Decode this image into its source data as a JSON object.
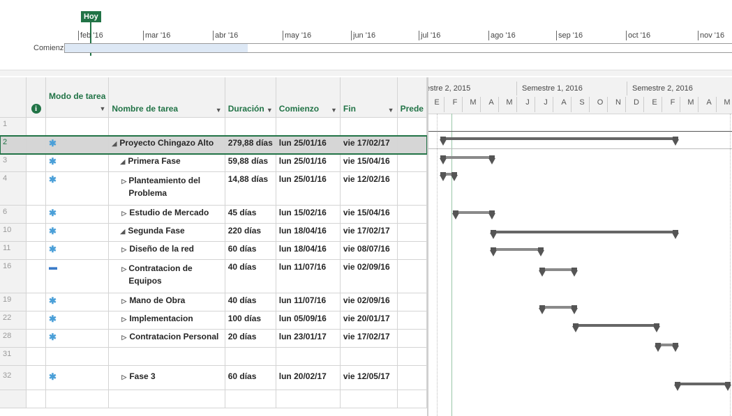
{
  "timeline": {
    "today_label": "Hoy",
    "start_label": "Comienzo",
    "months": [
      "feb '16",
      "mar '16",
      "abr '16",
      "may '16",
      "jun '16",
      "jul '16",
      "ago '16",
      "sep '16",
      "oct '16",
      "nov '16"
    ]
  },
  "grid": {
    "headers": {
      "info": "i",
      "mode": "Modo de tarea",
      "name": "Nombre de tarea",
      "duration": "Duración",
      "start": "Comienzo",
      "finish": "Fin",
      "pred": "Prede"
    },
    "rows": [
      {
        "id": "1",
        "mode": "",
        "name": "",
        "duration": "",
        "start": "",
        "finish": ""
      },
      {
        "id": "2",
        "mode": "pin",
        "name": "Proyecto Chingazo Alto",
        "duration": "279,88 días",
        "start": "lun 25/01/16",
        "finish": "vie 17/02/17"
      },
      {
        "id": "3",
        "mode": "pin",
        "name": "Primera Fase",
        "duration": "59,88 días",
        "start": "lun 25/01/16",
        "finish": "vie 15/04/16"
      },
      {
        "id": "4",
        "mode": "pin",
        "name": "Planteamiento del Problema",
        "duration": "14,88 días",
        "start": "lun 25/01/16",
        "finish": "vie 12/02/16"
      },
      {
        "id": "6",
        "mode": "pin",
        "name": "Estudio de Mercado",
        "duration": "45 días",
        "start": "lun 15/02/16",
        "finish": "vie 15/04/16"
      },
      {
        "id": "10",
        "mode": "pin",
        "name": "Segunda Fase",
        "duration": "220 días",
        "start": "lun 18/04/16",
        "finish": "vie 17/02/17"
      },
      {
        "id": "11",
        "mode": "pin",
        "name": "Diseño de la red",
        "duration": "60 días",
        "start": "lun 18/04/16",
        "finish": "vie 08/07/16"
      },
      {
        "id": "16",
        "mode": "auto",
        "name": "Contratacion de Equipos",
        "duration": "40 días",
        "start": "lun 11/07/16",
        "finish": "vie 02/09/16"
      },
      {
        "id": "19",
        "mode": "pin",
        "name": "Mano de Obra",
        "duration": "40 días",
        "start": "lun 11/07/16",
        "finish": "vie 02/09/16"
      },
      {
        "id": "22",
        "mode": "pin",
        "name": "Implementacion",
        "duration": "100 días",
        "start": "lun 05/09/16",
        "finish": "vie 20/01/17"
      },
      {
        "id": "28",
        "mode": "pin",
        "name": "Contratacion Personal",
        "duration": "20 días",
        "start": "lun 23/01/17",
        "finish": "vie 17/02/17"
      },
      {
        "id": "31",
        "mode": "",
        "name": "",
        "duration": "",
        "start": "",
        "finish": ""
      },
      {
        "id": "32",
        "mode": "pin",
        "name": "Fase 3",
        "duration": "60 días",
        "start": "lun 20/02/17",
        "finish": "vie 12/05/17"
      }
    ]
  },
  "gantt": {
    "semesters": [
      "estre 2, 2015",
      "Semestre 1, 2016",
      "Semestre 2, 2016"
    ],
    "months": [
      "E",
      "F",
      "M",
      "A",
      "M",
      "J",
      "J",
      "A",
      "S",
      "O",
      "N",
      "D",
      "E",
      "F",
      "M",
      "A",
      "M"
    ]
  }
}
